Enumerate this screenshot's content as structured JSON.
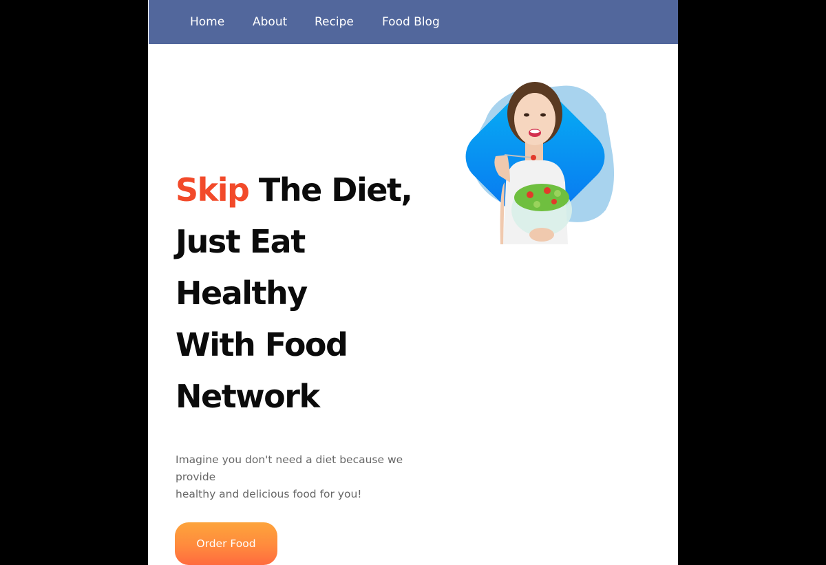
{
  "nav": {
    "items": [
      {
        "label": "Home"
      },
      {
        "label": "About"
      },
      {
        "label": "Recipe"
      },
      {
        "label": "Food Blog"
      }
    ]
  },
  "hero": {
    "title_highlight": "Skip",
    "title_line1_rest": " The Diet,",
    "title_line2": "Just Eat",
    "title_line3": "Healthy",
    "title_line4": "With Food",
    "title_line5": "Network",
    "description_line1": "Imagine you don't need a diet because we",
    "description_line2": "provide",
    "description_line3": "healthy and delicious food for you!",
    "cta_label": "Order Food"
  },
  "colors": {
    "navbar": "#52679c",
    "highlight": "#f24a2a",
    "button_gradient_top": "#fda43c",
    "button_gradient_bottom": "#ff6b3f",
    "image_blob_dark": "#0a86f5",
    "image_blob_light": "#a8d3ee"
  },
  "image": {
    "subject": "woman-eating-salad-illustration"
  }
}
